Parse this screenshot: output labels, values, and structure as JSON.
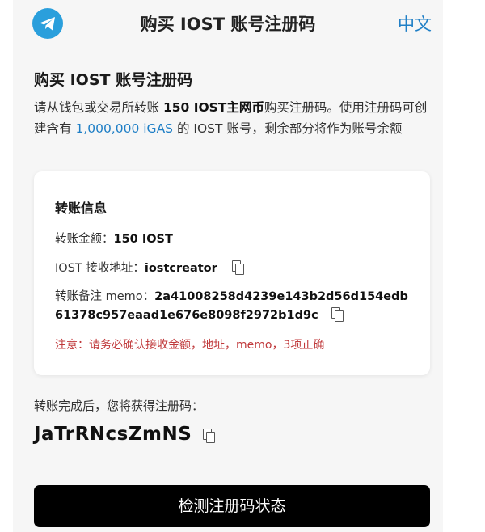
{
  "header": {
    "title": "购买 IOST 账号注册码",
    "lang_label": "中文",
    "logo_icon": "telegram-icon",
    "accent_color": "#2a9fdc"
  },
  "section": {
    "title": "购买 IOST 账号注册码",
    "intro_prefix": "请从钱包或交易所转账 ",
    "intro_amount": "150 IOST主网币",
    "intro_mid": "购买注册码。使用注册码可创建含有 ",
    "intro_link": "1,000,000 iGAS",
    "intro_suffix": " 的 IOST 账号，剩余部分将作为账号余额"
  },
  "transfer": {
    "title": "转账信息",
    "amount_label": "转账金额：",
    "amount_value": "150 IOST",
    "address_label": "IOST 接收地址：",
    "address_value": "iostcreator",
    "memo_label": "转账备注 memo：",
    "memo_line1": "2a41008258d4239e143b2d56d154edb",
    "memo_line2": "61378c957eaad1e676e8098f2972b1d9c",
    "warning": "注意：请务必确认接收金额，地址，memo，3项正确"
  },
  "result": {
    "label": "转账完成后，您将获得注册码：",
    "code": "JaTrRNcsZmNS"
  },
  "action": {
    "button_label": "检测注册码状态"
  }
}
